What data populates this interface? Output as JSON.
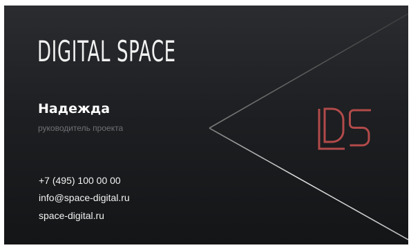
{
  "card": {
    "brand": "DIGITAL SPACE",
    "name": "Надежда",
    "role": "руководитель проекта",
    "phone": "+7 (495) 100 00 00",
    "email": "info@space-digital.ru",
    "website": "space-digital.ru",
    "logo_text": "DS"
  },
  "colors": {
    "background": "#1d1f22",
    "accent": "#b24a4a",
    "line": "#a8a8a8",
    "text": "#ffffff",
    "muted_text": "#6f7176"
  }
}
